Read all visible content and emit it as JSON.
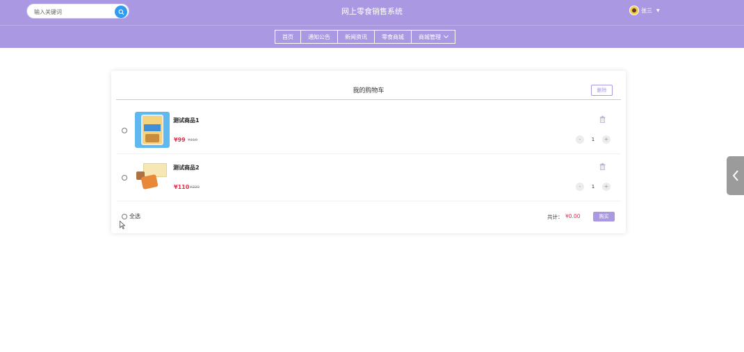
{
  "header": {
    "search_placeholder": "输入关键词",
    "site_title": "网上零食销售系统",
    "username": "张三",
    "accent_color": "#aa99e2"
  },
  "nav": {
    "items": [
      "首页",
      "通知公告",
      "新闻资讯",
      "零食商城",
      "商城管理"
    ]
  },
  "cart": {
    "title": "我的购物车",
    "delete_label": "删除",
    "items": [
      {
        "name": "测试商品1",
        "price": "¥99",
        "old_price": "¥110",
        "quantity": "1"
      },
      {
        "name": "测试商品2",
        "price": "¥110",
        "old_price": "¥220",
        "quantity": "1"
      }
    ],
    "select_all_label": "全选",
    "total_label": "共计：",
    "total_value": "¥0.00",
    "buy_label": "购买",
    "minus": "-",
    "plus": "+"
  }
}
